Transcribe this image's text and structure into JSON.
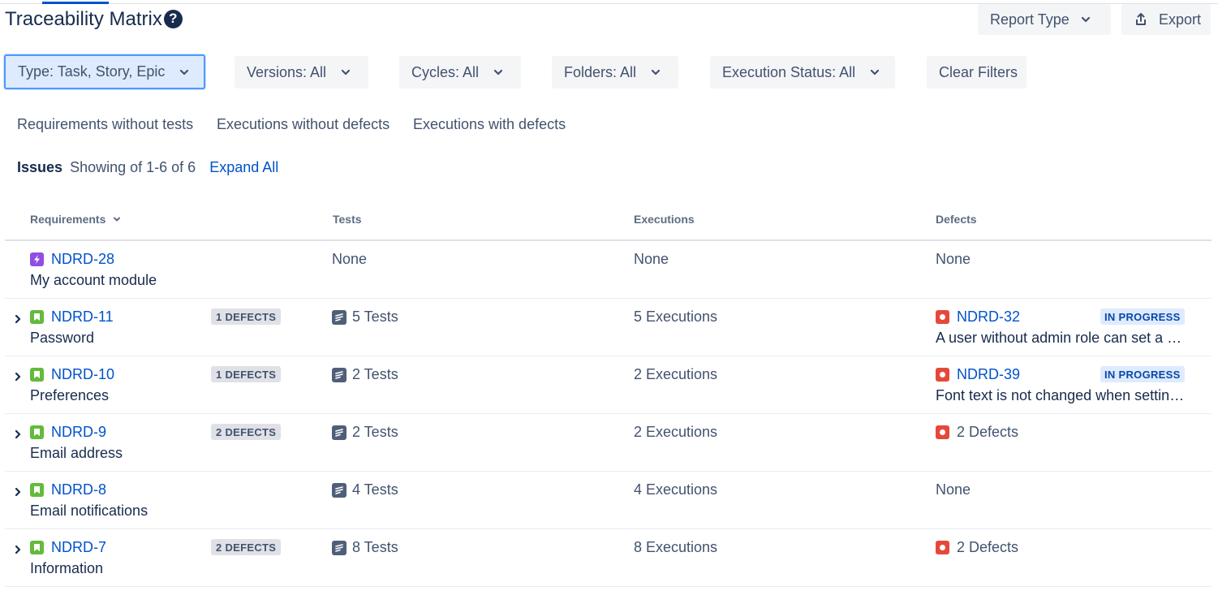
{
  "header": {
    "title": "Traceability Matrix",
    "help_icon": "question-circle-icon",
    "report_type_label": "Report Type",
    "export_label": "Export"
  },
  "filters": {
    "type": "Type: Task, Story, Epic",
    "versions": "Versions: All",
    "cycles": "Cycles: All",
    "folders": "Folders: All",
    "execution_status": "Execution Status: All",
    "clear": "Clear Filters"
  },
  "quick_filters": {
    "req_without_tests": "Requirements without tests",
    "exec_without_defects": "Executions without defects",
    "exec_with_defects": "Executions with defects"
  },
  "issues": {
    "label": "Issues",
    "showing": "Showing of 1-6 of 6",
    "expand_all": "Expand All"
  },
  "table": {
    "columns": {
      "requirements": "Requirements",
      "tests": "Tests",
      "executions": "Executions",
      "defects": "Defects"
    },
    "rows": [
      {
        "key": "NDRD-28",
        "summary": "My account module",
        "type": "epic",
        "expandable": false,
        "defects_badge": "",
        "tests": "None",
        "has_test_icon": false,
        "executions": "None",
        "defect_key": "",
        "defect_text": "None",
        "defect_is_link": false,
        "has_bug_icon": false,
        "defect_status": "",
        "defect_summary": ""
      },
      {
        "key": "NDRD-11",
        "summary": "Password",
        "type": "story",
        "expandable": true,
        "defects_badge": "1 DEFECTS",
        "tests": "5 Tests",
        "has_test_icon": true,
        "executions": "5 Executions",
        "defect_key": "NDRD-32",
        "defect_text": "NDRD-32",
        "defect_is_link": true,
        "has_bug_icon": true,
        "defect_status": "IN PROGRESS",
        "defect_summary": "A user without admin role can set a n…"
      },
      {
        "key": "NDRD-10",
        "summary": "Preferences",
        "type": "story",
        "expandable": true,
        "defects_badge": "1 DEFECTS",
        "tests": "2 Tests",
        "has_test_icon": true,
        "executions": "2 Executions",
        "defect_key": "NDRD-39",
        "defect_text": "NDRD-39",
        "defect_is_link": true,
        "has_bug_icon": true,
        "defect_status": "IN PROGRESS",
        "defect_summary": "Font text is not changed when setting…"
      },
      {
        "key": "NDRD-9",
        "summary": "Email address",
        "type": "story",
        "expandable": true,
        "defects_badge": "2 DEFECTS",
        "tests": "2 Tests",
        "has_test_icon": true,
        "executions": "2 Executions",
        "defect_key": "",
        "defect_text": "2 Defects",
        "defect_is_link": false,
        "has_bug_icon": true,
        "defect_status": "",
        "defect_summary": ""
      },
      {
        "key": "NDRD-8",
        "summary": "Email notifications",
        "type": "story",
        "expandable": true,
        "defects_badge": "",
        "tests": "4 Tests",
        "has_test_icon": true,
        "executions": "4 Executions",
        "defect_key": "",
        "defect_text": "None",
        "defect_is_link": false,
        "has_bug_icon": false,
        "defect_status": "",
        "defect_summary": ""
      },
      {
        "key": "NDRD-7",
        "summary": "Information",
        "type": "story",
        "expandable": true,
        "defects_badge": "2 DEFECTS",
        "tests": "8 Tests",
        "has_test_icon": true,
        "executions": "8 Executions",
        "defect_key": "",
        "defect_text": "2 Defects",
        "defect_is_link": false,
        "has_bug_icon": true,
        "defect_status": "",
        "defect_summary": ""
      }
    ]
  },
  "colors": {
    "link": "#0052cc",
    "story": "#63ba3c",
    "epic": "#904ee2",
    "bug": "#e5493a",
    "in_progress_bg": "#deebff"
  }
}
